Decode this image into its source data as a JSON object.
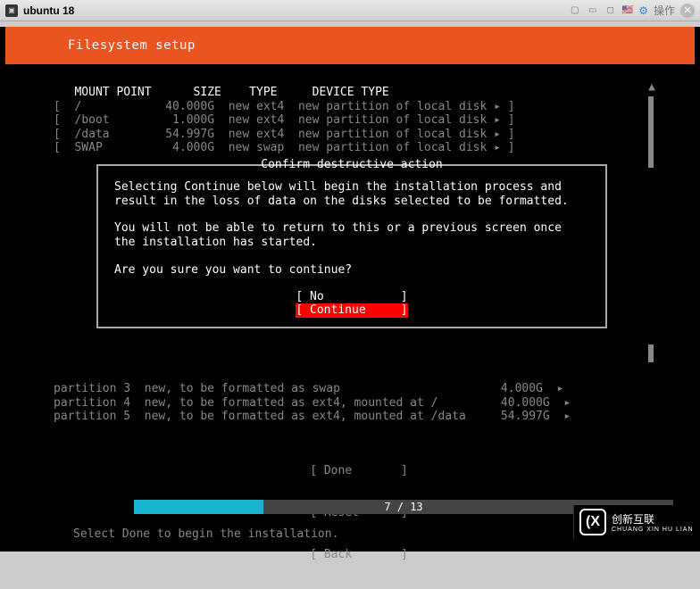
{
  "titlebar": {
    "title": "ubuntu 18",
    "operate_label": "操作"
  },
  "header": {
    "title": "Filesystem setup"
  },
  "table": {
    "headers": {
      "mount": "MOUNT POINT",
      "size": "SIZE",
      "type": "TYPE",
      "device": "DEVICE TYPE"
    },
    "rows": [
      {
        "mount": "/",
        "size": "40.000G",
        "type": "new ext4",
        "device": "new partition of local disk"
      },
      {
        "mount": "/boot",
        "size": "1.000G",
        "type": "new ext4",
        "device": "new partition of local disk"
      },
      {
        "mount": "/data",
        "size": "54.997G",
        "type": "new ext4",
        "device": "new partition of local disk"
      },
      {
        "mount": "SWAP",
        "size": "4.000G",
        "type": "new swap",
        "device": "new partition of local disk"
      }
    ]
  },
  "dialog": {
    "title": "Confirm destructive action",
    "p1": "Selecting Continue below will begin the installation process and result in the loss of data on the disks selected to be formatted.",
    "p2": "You will not be able to return to this or a previous screen once the installation has started.",
    "p3": "Are you sure you want to continue?",
    "no": "No",
    "continue": "Continue"
  },
  "partitions": [
    {
      "label": "partition 3  new, to be formatted as swap",
      "size": "4.000G"
    },
    {
      "label": "partition 4  new, to be formatted as ext4, mounted at /",
      "size": "40.000G"
    },
    {
      "label": "partition 5  new, to be formatted as ext4, mounted at /data",
      "size": "54.997G"
    }
  ],
  "bottom_buttons": {
    "done": "Done",
    "reset": "Reset",
    "back": "Back"
  },
  "progress": {
    "text": "7 / 13"
  },
  "hint": "Select Done to begin the installation.",
  "logo": {
    "cn": "创新互联",
    "en": "CHUANG XIN HU LIAN",
    "mark": "(X"
  }
}
